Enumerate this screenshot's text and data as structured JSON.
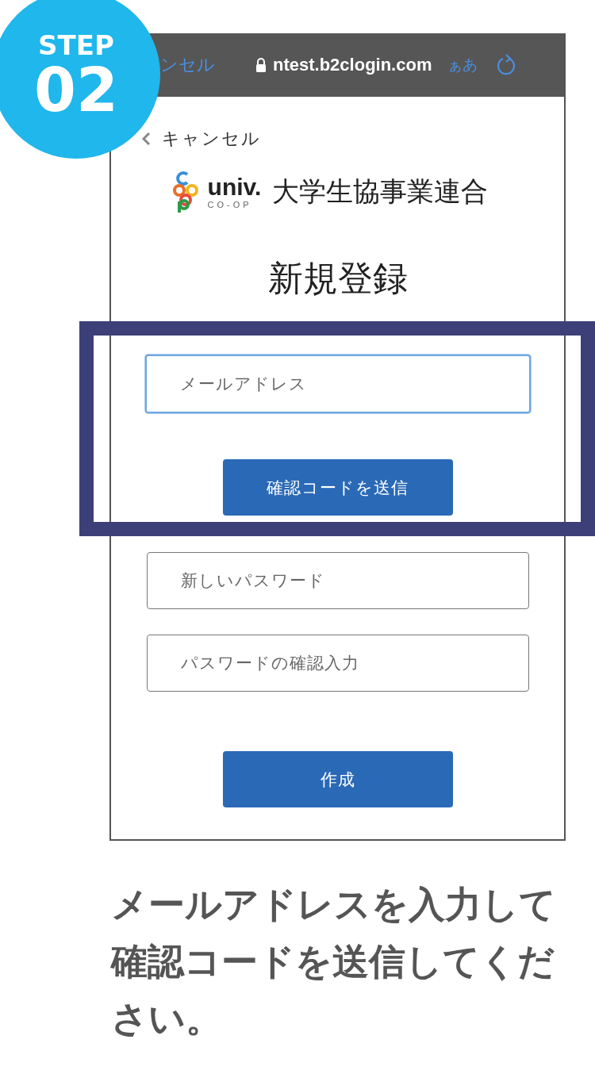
{
  "badge": {
    "label": "STEP",
    "number": "02"
  },
  "browser_bar": {
    "back_text": "ンセル",
    "url": "ntest.b2clogin.com",
    "text_size_button": "ぁあ"
  },
  "page": {
    "back_link": "キャンセル",
    "logo": {
      "wordmark": "univ.",
      "sub": "CO-OP",
      "org_name": "大学生協事業連合"
    },
    "title": "新規登録",
    "items": [
      {
        "kind": "field",
        "placeholder": "メールアドレス",
        "focused": true
      },
      {
        "kind": "button",
        "label": "確認コードを送信"
      },
      {
        "kind": "field",
        "placeholder": "新しいパスワード",
        "focused": false
      },
      {
        "kind": "field",
        "placeholder": "パスワードの確認入力",
        "focused": false
      },
      {
        "kind": "button",
        "label": "作成"
      }
    ]
  },
  "caption": "メールアドレスを入力して確認コードを送信してください。"
}
